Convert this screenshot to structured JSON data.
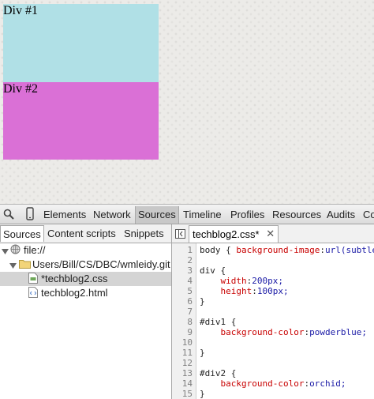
{
  "page": {
    "div1": {
      "label": "Div #1",
      "background": "#b0e0e6"
    },
    "div2": {
      "label": "Div #2",
      "background": "#da70d6"
    }
  },
  "devtools": {
    "toolbar": {
      "icons": [
        "magnifier-icon",
        "device-mobile-icon"
      ],
      "tabs": [
        "Elements",
        "Network",
        "Sources",
        "Timeline",
        "Profiles",
        "Resources",
        "Audits",
        "Co"
      ],
      "selected_tab": "Sources"
    },
    "navigator": {
      "tabs": [
        "Sources",
        "Content scripts",
        "Snippets"
      ],
      "selected_tab": "Sources",
      "tree": [
        {
          "label": "file://",
          "icon": "globe-icon",
          "expanded": true
        },
        {
          "label": "Users/Bill/CS/DBC/wmleidy.git",
          "icon": "folder-icon",
          "expanded": true
        },
        {
          "label": "*techblog2.css",
          "icon": "css-file-icon",
          "selected": true
        },
        {
          "label": "techblog2.html",
          "icon": "html-file-icon"
        }
      ]
    },
    "editor": {
      "open_tab": "techblog2.css*",
      "lines": [
        {
          "n": "1",
          "text": "body { background-image:url(subtle"
        },
        {
          "n": "2",
          "text": ""
        },
        {
          "n": "3",
          "text": "div {"
        },
        {
          "n": "4",
          "text": "    width:200px;"
        },
        {
          "n": "5",
          "text": "    height:100px;"
        },
        {
          "n": "6",
          "text": "}"
        },
        {
          "n": "7",
          "text": ""
        },
        {
          "n": "8",
          "text": "#div1 {"
        },
        {
          "n": "9",
          "text": "    background-color:powderblue;"
        },
        {
          "n": "10",
          "text": ""
        },
        {
          "n": "11",
          "text": "}"
        },
        {
          "n": "12",
          "text": ""
        },
        {
          "n": "13",
          "text": "#div2 {"
        },
        {
          "n": "14",
          "text": "    background-color:orchid;"
        },
        {
          "n": "15",
          "text": "}"
        }
      ]
    }
  }
}
